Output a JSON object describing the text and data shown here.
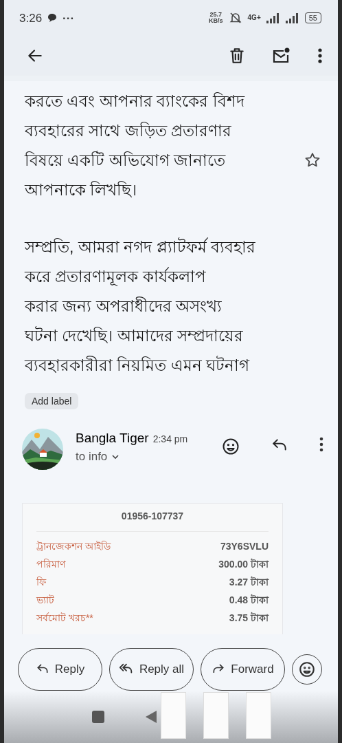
{
  "status_bar": {
    "time": "3:26",
    "overflow": "···",
    "speed": "25.7",
    "speed_unit": "KB/s",
    "network": "4G+",
    "battery": "55"
  },
  "message": {
    "paragraphs": [
      "করতে এবং আপনার ব্যাংকের বিশদ\nব্যবহারের সাথে জড়িত প্রতারণার\nবিষয়ে একটি অভিযোগ জানাতে\nআপনাকে লিখছি।",
      "সম্প্রতি, আমরা নগদ প্ল্যাটফর্ম ব্যবহার\nকরে প্রতারণামূলক কার্যকলাপ\nকরার জন্য অপরাধীদের অসংখ্য\nঘটনা দেখেছি। আমাদের সম্প্রদায়ের\nব্যবহারকারীরা নিয়মিত এমন ঘটনাগ"
    ],
    "starred": false,
    "label_chip": "Add label"
  },
  "reply": {
    "sender": "Bangla Tiger",
    "time": "2:34 pm",
    "recipient": "to info",
    "receipt": {
      "phone": "01956-107737",
      "rows": [
        {
          "label": "ট্রানজেকশন আইডি",
          "value": "73Y6SVLU"
        },
        {
          "label": "পরিমাণ",
          "value": "300.00 টাকা"
        },
        {
          "label": "ফি",
          "value": "3.27 টাকা"
        },
        {
          "label": "ভ্যাট",
          "value": "0.48 টাকা"
        },
        {
          "label": "সর্বমোট খরচ**",
          "value": "3.75 টাকা"
        }
      ]
    }
  },
  "actions": [
    {
      "kind": "reply",
      "label": "Reply"
    },
    {
      "kind": "reply_all",
      "label": "Reply all"
    },
    {
      "kind": "forward",
      "label": "Forward"
    },
    {
      "kind": "emoji"
    }
  ]
}
